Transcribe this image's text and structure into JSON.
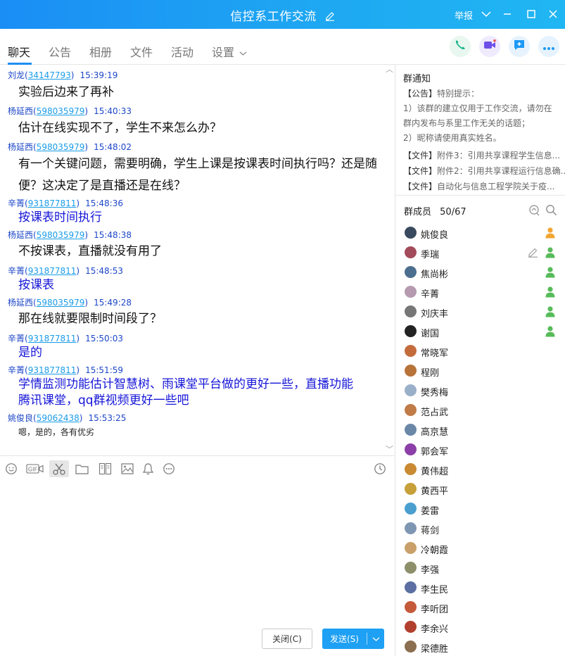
{
  "window": {
    "title": "信控系工作交流",
    "report_label": "举报"
  },
  "tabs": [
    {
      "label": "聊天",
      "active": true
    },
    {
      "label": "公告"
    },
    {
      "label": "相册"
    },
    {
      "label": "文件"
    },
    {
      "label": "活动"
    },
    {
      "label": "设置"
    }
  ],
  "messages": [
    {
      "name": "刘龙",
      "uid": "34147793",
      "time": "15:39:19",
      "text": [
        "实验后边来了再补"
      ],
      "style": "normal"
    },
    {
      "name": "杨延西",
      "uid": "598035979",
      "time": "15:40:33",
      "text": [
        "估计在线实现不了，学生不来怎么办？"
      ],
      "style": "normal"
    },
    {
      "name": "杨延西",
      "uid": "598035979",
      "time": "15:48:02",
      "text": [
        "有一个关键问题，需要明确，学生上课是按课表时间执行吗？还是随",
        "便？这决定了是直播还是在线？"
      ],
      "style": "normal"
    },
    {
      "name": "辛菁",
      "uid": "931877811",
      "time": "15:48:36",
      "text": [
        "按课表时间执行"
      ],
      "style": "blue"
    },
    {
      "name": "杨延西",
      "uid": "598035979",
      "time": "15:48:38",
      "text": [
        "不按课表，直播就没有用了"
      ],
      "style": "normal"
    },
    {
      "name": "辛菁",
      "uid": "931877811",
      "time": "15:48:53",
      "text": [
        "按课表"
      ],
      "style": "blue"
    },
    {
      "name": "杨延西",
      "uid": "598035979",
      "time": "15:49:28",
      "text": [
        "那在线就要限制时间段了？"
      ],
      "style": "normal"
    },
    {
      "name": "辛菁",
      "uid": "931877811",
      "time": "15:50:03",
      "text": [
        "是的"
      ],
      "style": "blue"
    },
    {
      "name": "辛菁",
      "uid": "931877811",
      "time": "15:51:59",
      "text": [
        "学情监测功能估计智慧树、雨课堂平台做的更好一些，直播功能",
        "腾讯课堂，qq群视频更好一些吧"
      ],
      "style": "blue"
    },
    {
      "name": "姚俊良",
      "uid": "59062438",
      "time": "15:53:25",
      "text": [
        "嗯，是的，各有优劣"
      ],
      "style": "small"
    }
  ],
  "buttons": {
    "close": "关闭(C)",
    "send": "发送(S)"
  },
  "notice": {
    "heading": "群通知",
    "lines": [
      {
        "tag": "【公告】",
        "text": "特别提示："
      },
      {
        "tag": "",
        "text": "1）该群的建立仅用于工作交流，请勿在"
      },
      {
        "tag": "",
        "text": "群内发布与系里工作无关的话题；"
      },
      {
        "tag": "",
        "text": "2）昵称请使用真实姓名。"
      },
      {
        "tag": "【文件】",
        "text": "附件3：引用共享课程学生信息..."
      },
      {
        "tag": "【文件】",
        "text": "附件2：引用共享课程运行信息确..."
      },
      {
        "tag": "【文件】",
        "text": "自动化与信息工程学院关于疫..."
      }
    ]
  },
  "members": {
    "label": "群成员",
    "online": "50",
    "total": "67",
    "list": [
      {
        "name": "姚俊良",
        "status": "admin",
        "color": "#3a4a5e"
      },
      {
        "name": "季瑞",
        "status": "owner",
        "color": "#a24b5a",
        "editable": true
      },
      {
        "name": "焦尚彬",
        "status": "owner",
        "color": "#4c6f8f"
      },
      {
        "name": "辛菁",
        "status": "owner",
        "color": "#b59ab0"
      },
      {
        "name": "刘庆丰",
        "status": "owner",
        "color": "#767676"
      },
      {
        "name": "谢国",
        "status": "owner",
        "color": "#222222"
      },
      {
        "name": "常晓军",
        "status": "",
        "color": "#c46b3c"
      },
      {
        "name": "程刚",
        "status": "",
        "color": "#b7733a"
      },
      {
        "name": "樊秀梅",
        "status": "",
        "color": "#9ab0c8"
      },
      {
        "name": "范占武",
        "status": "",
        "color": "#c07b47"
      },
      {
        "name": "高京慧",
        "status": "",
        "color": "#6a87a8"
      },
      {
        "name": "郭会军",
        "status": "",
        "color": "#8c3fa8"
      },
      {
        "name": "黄伟超",
        "status": "",
        "color": "#c98a32"
      },
      {
        "name": "黄西平",
        "status": "",
        "color": "#c7a03a"
      },
      {
        "name": "姜雷",
        "status": "",
        "color": "#4a9fcf"
      },
      {
        "name": "蒋剑",
        "status": "",
        "color": "#7f96b3"
      },
      {
        "name": "冷朝霞",
        "status": "",
        "color": "#c9a06a"
      },
      {
        "name": "李强",
        "status": "",
        "color": "#8c8f6a"
      },
      {
        "name": "李生民",
        "status": "",
        "color": "#5b6fa3"
      },
      {
        "name": "李听团",
        "status": "",
        "color": "#c55a3a"
      },
      {
        "name": "李余兴",
        "status": "",
        "color": "#b2402e"
      },
      {
        "name": "梁德胜",
        "status": "",
        "color": "#8a6e4f"
      }
    ]
  },
  "colors": {
    "title_bar": "#1ea7f2",
    "accent": "#1e8ef0",
    "phone_button": "#1bb58a",
    "video_button": "#6d4ee8",
    "chat_button": "#1e9af5",
    "more_button": "#1e9af5"
  }
}
